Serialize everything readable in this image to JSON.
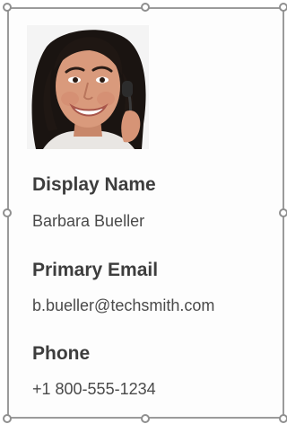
{
  "contact_card": {
    "display_name_label": "Display Name",
    "display_name_value": "Barbara Bueller",
    "primary_email_label": "Primary Email",
    "primary_email_value": "b.bueller@techsmith.com",
    "phone_label": "Phone",
    "phone_value": "+1 800-555-1234"
  },
  "icons": {
    "avatar": "profile-photo",
    "selection_handle": "resize-handle"
  },
  "colors": {
    "frame_border": "#9b9b9b",
    "label_text": "#3d3d3d",
    "value_text": "#4a4a4a"
  }
}
